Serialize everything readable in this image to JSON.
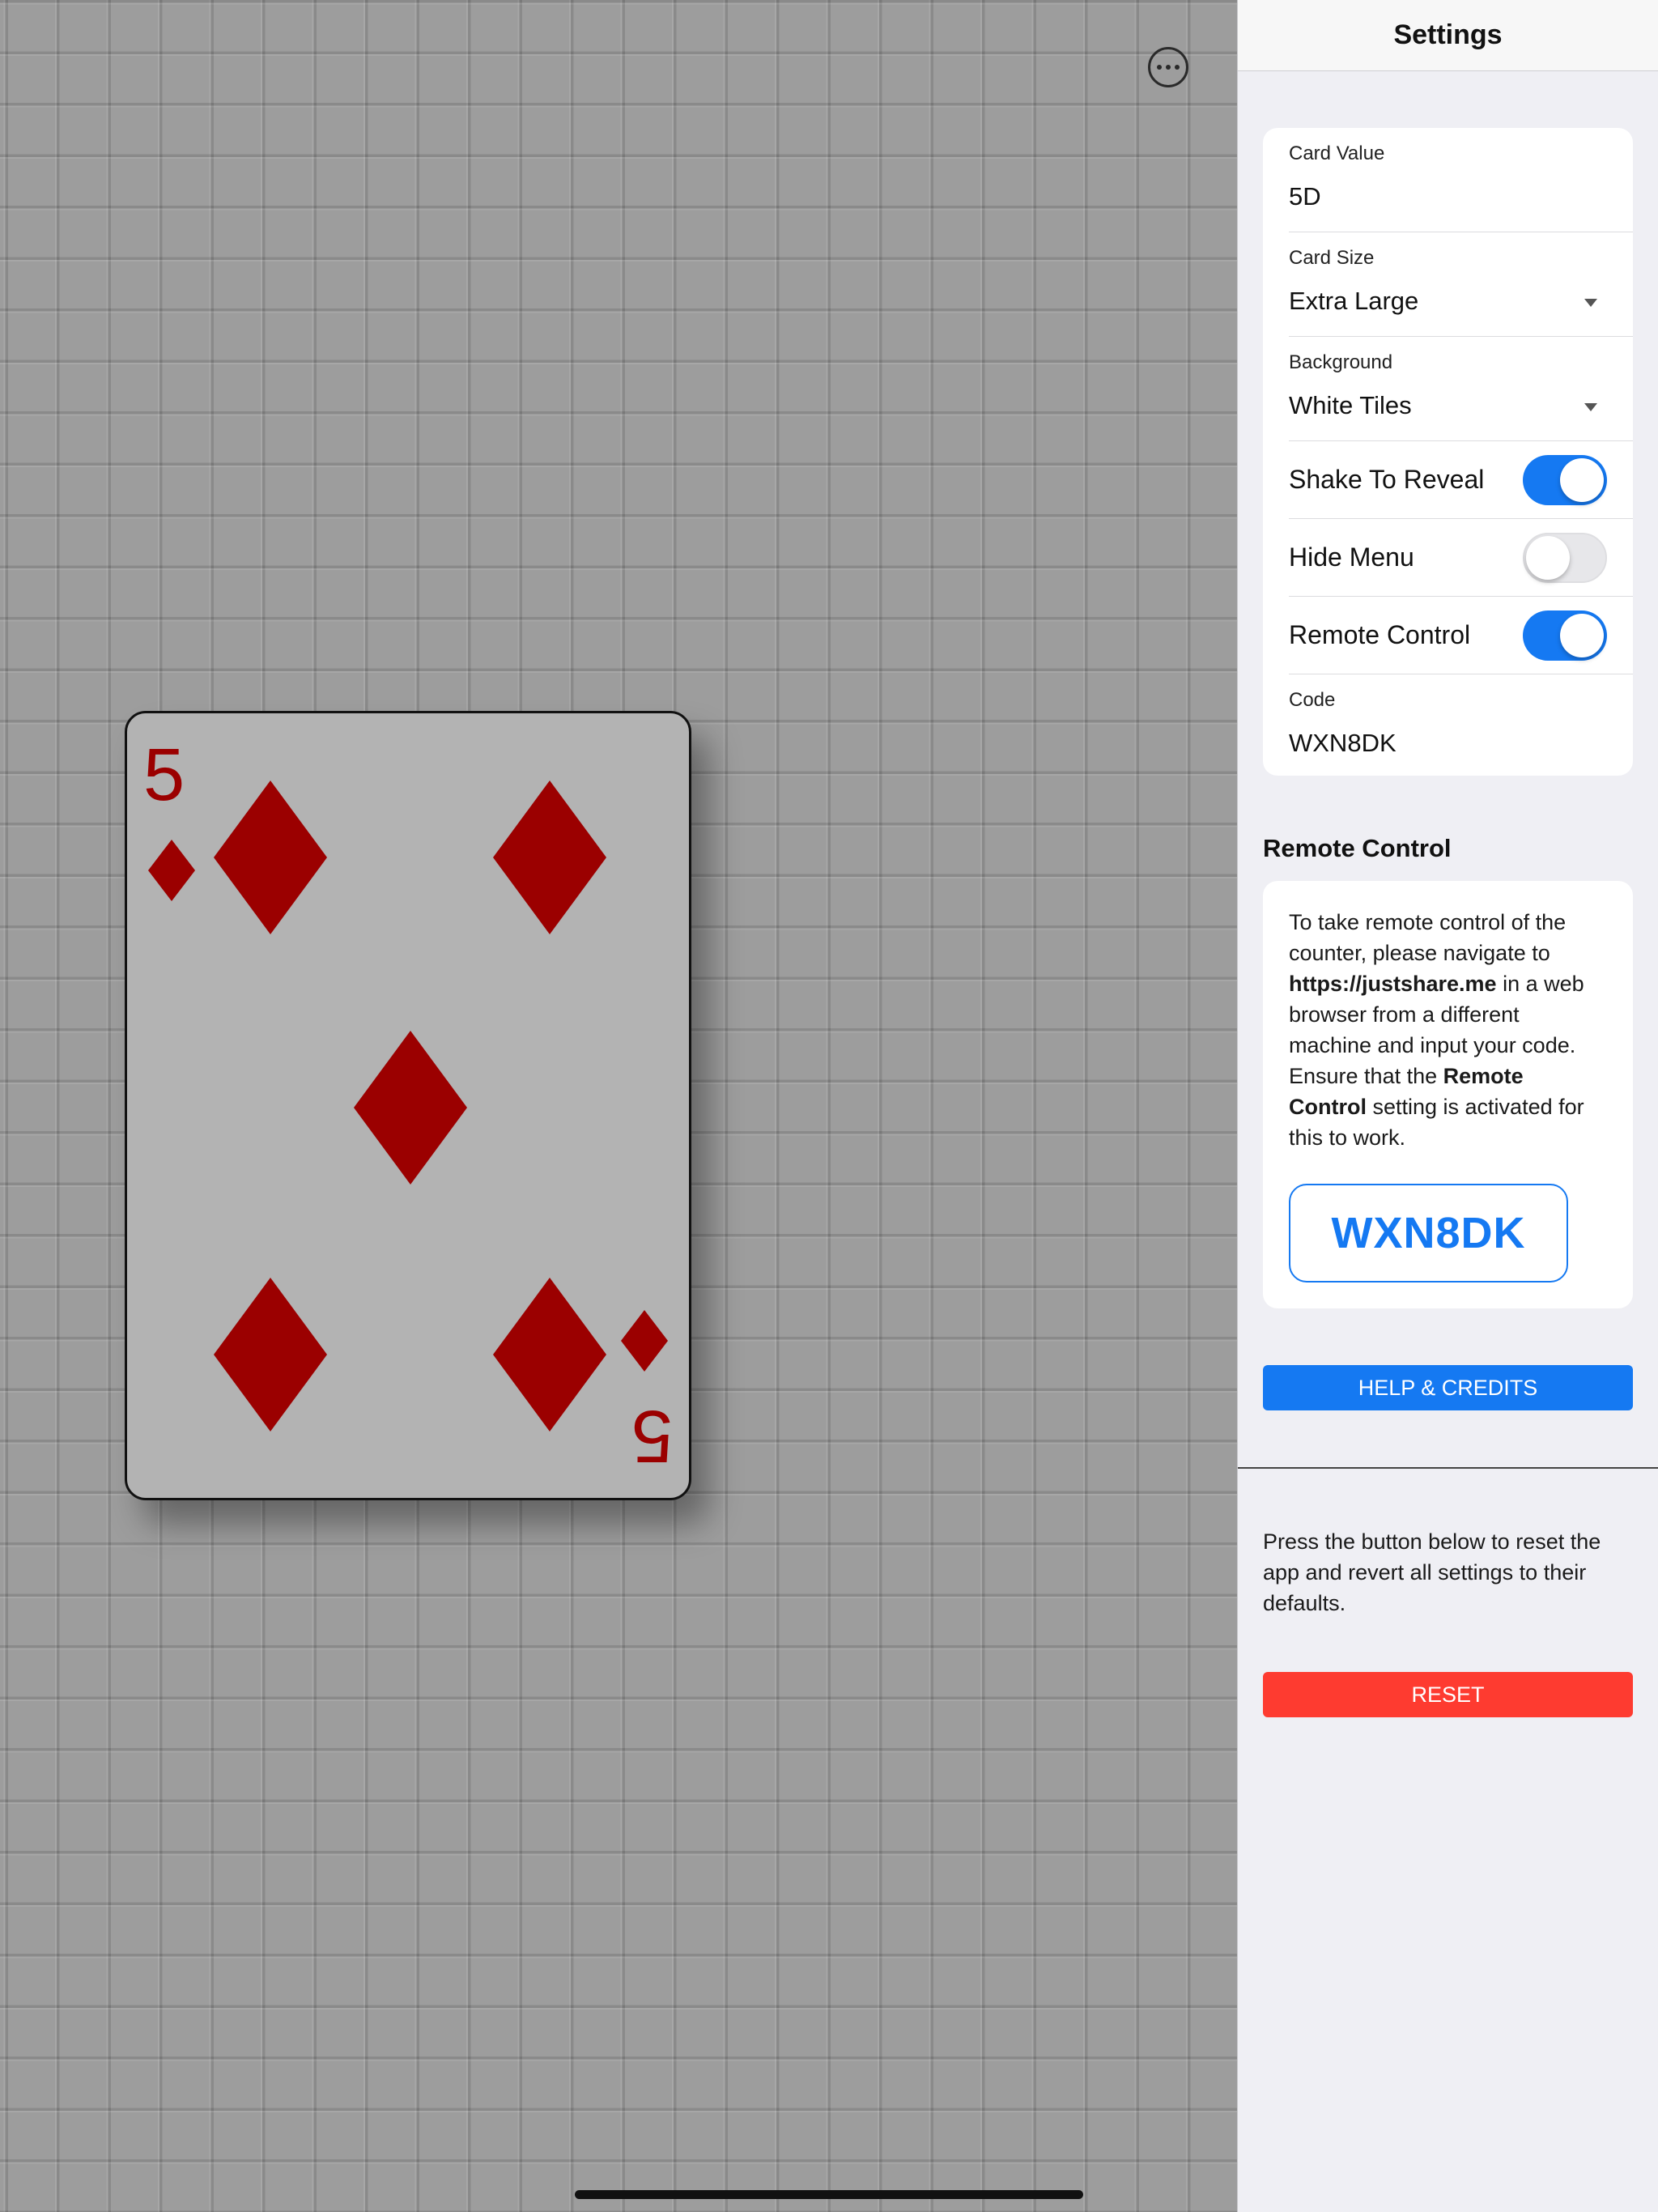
{
  "settings_panel": {
    "title": "Settings",
    "fields": {
      "card_value": {
        "label": "Card Value",
        "value": "5D"
      },
      "card_size": {
        "label": "Card Size",
        "value": "Extra Large"
      },
      "background": {
        "label": "Background",
        "value": "White Tiles"
      },
      "shake_to_reveal": {
        "label": "Shake To Reveal",
        "on": true
      },
      "hide_menu": {
        "label": "Hide Menu",
        "on": false
      },
      "remote_control": {
        "label": "Remote Control",
        "on": true
      },
      "code": {
        "label": "Code",
        "value": "WXN8DK"
      }
    },
    "remote_section": {
      "heading": "Remote Control",
      "text_1": "To take remote control of the counter, please navigate to ",
      "url": "https://justshare.me",
      "text_2": " in a web browser from a different machine and input your code. Ensure that the ",
      "setting_name": "Remote Control",
      "text_3": " setting is activated for this to work.",
      "code": "WXN8DK"
    },
    "help_button": "HELP & CREDITS",
    "reset_text": "Press the button below to reset the app and revert all settings to their defaults.",
    "reset_button": "RESET"
  },
  "card": {
    "rank": "5",
    "suit": "diamonds",
    "color": "#9b0000"
  },
  "icons": {
    "menu": "more-horizontal-circle-icon"
  },
  "colors": {
    "accent": "#1579f2",
    "danger": "#fe3b30",
    "card_face": "#b3b3b3"
  }
}
